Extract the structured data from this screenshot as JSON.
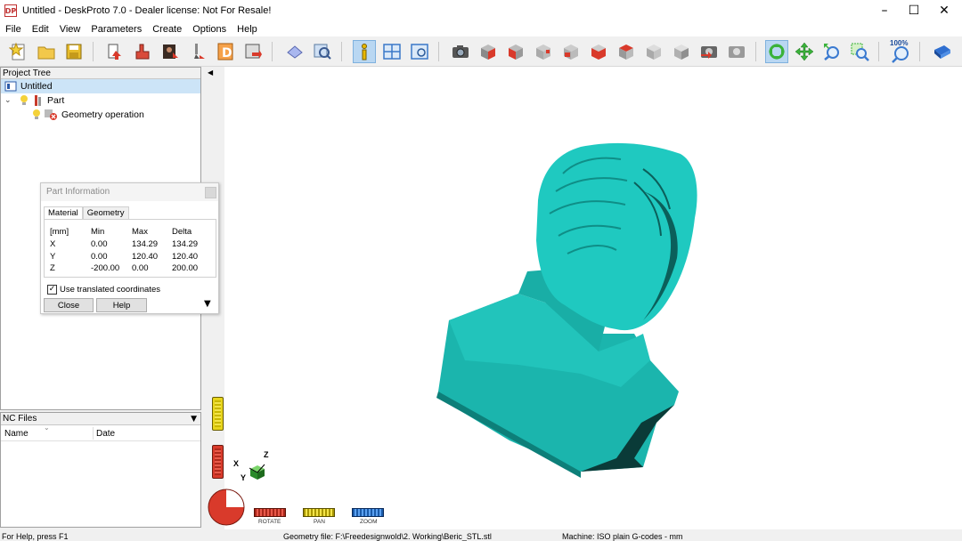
{
  "window": {
    "title": "Untitled - DeskProto 7.0 - Dealer license: Not For Resale!",
    "app_icon": "DP",
    "minimize": "–",
    "maximize": "☐",
    "close": "✕"
  },
  "menu": [
    "File",
    "Edit",
    "View",
    "Parameters",
    "Create",
    "Options",
    "Help"
  ],
  "toolbar": {
    "zoom_100_label": "100%"
  },
  "project_tree": {
    "header": "Project Tree",
    "root": "Untitled",
    "part": "Part",
    "operation": "Geometry operation"
  },
  "part_info": {
    "title": "Part Information",
    "tabs": [
      "Material",
      "Geometry"
    ],
    "columns": [
      "[mm]",
      "Min",
      "Max",
      "Delta"
    ],
    "rows": [
      {
        "axis": "X",
        "min": "0.00",
        "max": "134.29",
        "delta": "134.29"
      },
      {
        "axis": "Y",
        "min": "0.00",
        "max": "120.40",
        "delta": "120.40"
      },
      {
        "axis": "Z",
        "min": "-200.00",
        "max": "0.00",
        "delta": "200.00"
      }
    ],
    "checkbox_label": "Use translated coordinates",
    "checkbox_checked": true,
    "close_label": "Close",
    "help_label": "Help"
  },
  "nc_files": {
    "header": "NC Files",
    "col_name": "Name",
    "col_date": "Date"
  },
  "navigation": {
    "rotate": "ROTATE",
    "pan": "PAN",
    "zoom": "ZOOM"
  },
  "axes": {
    "x": "X",
    "y": "Y",
    "z": "Z"
  },
  "status": {
    "help": "For Help, press F1",
    "geometry_file": "Geometry file: F:\\Freedesignwold\\2. Working\\Beric_STL.stl",
    "machine": "Machine: ISO plain G-codes - mm"
  },
  "colors": {
    "model": "#1fc9c0",
    "model_shadow": "#0b5f5a",
    "selection": "#cce4f7",
    "rotate_red": "#d93a2b",
    "pan_yellow": "#e8d51c",
    "zoom_blue": "#2f7fd8"
  }
}
